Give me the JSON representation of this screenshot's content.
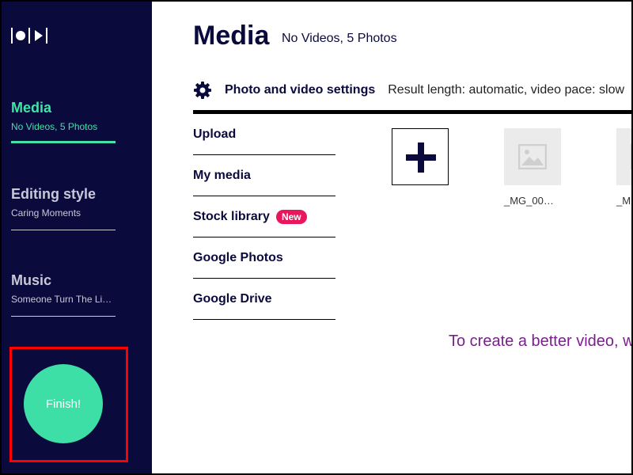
{
  "sidebar": {
    "items": [
      {
        "title": "Media",
        "subtitle": "No Videos, 5 Photos"
      },
      {
        "title": "Editing style",
        "subtitle": "Caring Moments"
      },
      {
        "title": "Music",
        "subtitle": "Someone Turn The Li…"
      }
    ],
    "finish_label": "Finish!"
  },
  "main": {
    "title": "Media",
    "subtitle": "No Videos, 5 Photos",
    "settings": {
      "label": "Photo and video settings",
      "value": "Result length: automatic, video pace: slow"
    },
    "sources": [
      {
        "label": "Upload",
        "badge": ""
      },
      {
        "label": "My media",
        "badge": ""
      },
      {
        "label": "Stock library",
        "badge": "New"
      },
      {
        "label": "Google Photos",
        "badge": ""
      },
      {
        "label": "Google Drive",
        "badge": ""
      }
    ],
    "thumbnails": [
      {
        "label": "_MG_00…"
      },
      {
        "label": "_M"
      }
    ],
    "hint": "To create a better video, w"
  },
  "colors": {
    "sidebar_bg": "#0b0a3c",
    "accent": "#40e3a8",
    "finish": "#3ddfa6",
    "badge": "#e8175d",
    "hint": "#7b1f8e",
    "highlight": "#ff0000"
  },
  "icons": [
    "logo-icon",
    "gear-icon",
    "plus-icon",
    "image-placeholder-icon"
  ]
}
